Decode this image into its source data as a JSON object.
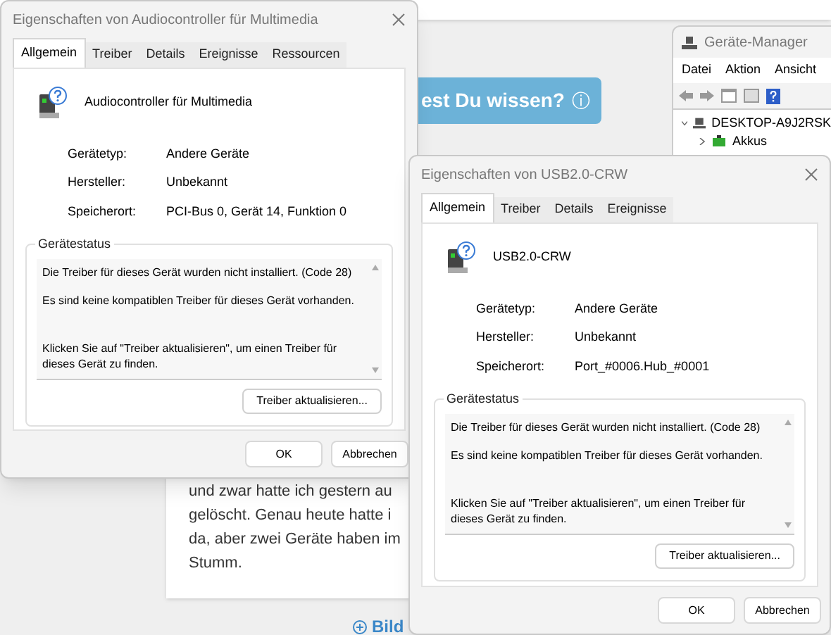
{
  "background": {
    "help_button": {
      "label": "est Du wissen?",
      "icon": "ⓘ"
    },
    "post_lines": [
      "und zwar hatte ich gestern au",
      "gelöscht. Genau heute hatte i",
      "da, aber zwei Geräte haben im",
      "Stumm."
    ],
    "add_link": "Bild"
  },
  "device_manager": {
    "title": "Geräte-Manager",
    "menu": [
      "Datei",
      "Aktion",
      "Ansicht"
    ],
    "tree": [
      {
        "label": "DESKTOP-A9J2RSK",
        "expanded": true,
        "children": [
          {
            "label": "Akkus",
            "expanded": false
          }
        ]
      }
    ]
  },
  "dialogs": [
    {
      "title": "Eigenschaften von Audiocontroller für Multimedia",
      "tabs": [
        {
          "label": "Allgemein",
          "selected": true
        },
        {
          "label": "Treiber",
          "selected": false
        },
        {
          "label": "Details",
          "selected": false
        },
        {
          "label": "Ereignisse",
          "selected": false
        },
        {
          "label": "Ressourcen",
          "selected": false
        }
      ],
      "device_name": "Audiocontroller für Multimedia",
      "properties": [
        {
          "label": "Gerätetyp:",
          "value": "Andere Geräte"
        },
        {
          "label": "Hersteller:",
          "value": "Unbekannt"
        },
        {
          "label": "Speicherort:",
          "value": "PCI-Bus 0, Gerät 14, Funktion 0"
        }
      ],
      "status_title": "Gerätestatus",
      "status_paragraphs": [
        "Die Treiber für dieses Gerät wurden nicht installiert. (Code 28)",
        "Es sind keine kompatiblen Treiber für dieses Gerät vorhanden.",
        "Klicken Sie auf \"Treiber aktualisieren\", um einen Treiber für dieses Gerät zu finden."
      ],
      "update_button": "Treiber aktualisieren...",
      "buttons": [
        "OK",
        "Abbrechen"
      ]
    },
    {
      "title": "Eigenschaften von USB2.0-CRW",
      "tabs": [
        {
          "label": "Allgemein",
          "selected": true
        },
        {
          "label": "Treiber",
          "selected": false
        },
        {
          "label": "Details",
          "selected": false
        },
        {
          "label": "Ereignisse",
          "selected": false
        }
      ],
      "device_name": "USB2.0-CRW",
      "properties": [
        {
          "label": "Gerätetyp:",
          "value": "Andere Geräte"
        },
        {
          "label": "Hersteller:",
          "value": "Unbekannt"
        },
        {
          "label": "Speicherort:",
          "value": "Port_#0006.Hub_#0001"
        }
      ],
      "status_title": "Gerätestatus",
      "status_paragraphs": [
        "Die Treiber für dieses Gerät wurden nicht installiert. (Code 28)",
        "Es sind keine kompatiblen Treiber für dieses Gerät vorhanden.",
        "Klicken Sie auf \"Treiber aktualisieren\", um einen Treiber für dieses Gerät zu finden."
      ],
      "update_button": "Treiber aktualisieren...",
      "buttons": [
        "OK",
        "Abbrechen"
      ]
    }
  ]
}
